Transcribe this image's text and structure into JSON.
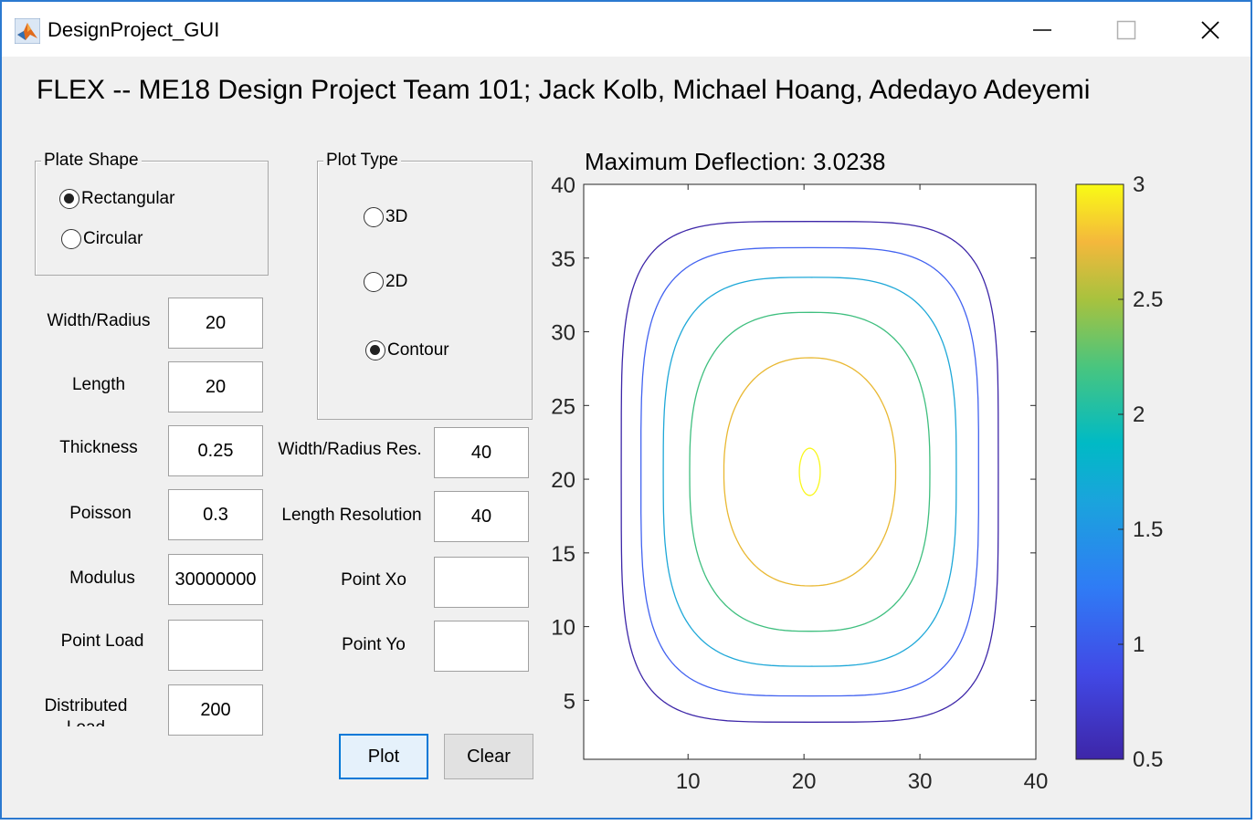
{
  "window": {
    "title": "DesignProject_GUI"
  },
  "heading": "FLEX -- ME18 Design Project Team 101; Jack Kolb, Michael Hoang, Adedayo Adeyemi",
  "plate_shape": {
    "title": "Plate Shape",
    "options": [
      {
        "label": "Rectangular",
        "selected": true
      },
      {
        "label": "Circular",
        "selected": false
      }
    ]
  },
  "plot_type": {
    "title": "Plot Type",
    "options": [
      {
        "label": "3D",
        "selected": false
      },
      {
        "label": "2D",
        "selected": false
      },
      {
        "label": "Contour",
        "selected": true
      }
    ]
  },
  "inputs": {
    "width_radius": {
      "label": "Width/Radius",
      "value": "20"
    },
    "length": {
      "label": "Length",
      "value": "20"
    },
    "thickness": {
      "label": "Thickness",
      "value": "0.25"
    },
    "poisson": {
      "label": "Poisson",
      "value": "0.3"
    },
    "modulus": {
      "label": "Modulus",
      "value": "30000000"
    },
    "point_load": {
      "label": "Point Load",
      "value": ""
    },
    "distributed_load": {
      "label": "Distributed Load",
      "value": "200"
    },
    "width_radius_res": {
      "label": "Width/Radius Res.",
      "value": "40"
    },
    "length_resolution": {
      "label": "Length Resolution",
      "value": "40"
    },
    "point_xo": {
      "label": "Point Xo",
      "value": ""
    },
    "point_yo": {
      "label": "Point Yo",
      "value": ""
    }
  },
  "buttons": {
    "plot": "Plot",
    "clear": "Clear"
  },
  "chart_data": {
    "type": "contour",
    "title": "Maximum Deflection: 3.0238",
    "xlim": [
      1,
      40
    ],
    "ylim": [
      1,
      40
    ],
    "x_ticks": [
      "10",
      "20",
      "30",
      "40"
    ],
    "y_ticks": [
      "5",
      "10",
      "15",
      "20",
      "25",
      "30",
      "35",
      "40"
    ],
    "contour_levels": [
      0.5,
      1,
      1.5,
      2,
      2.5,
      3
    ],
    "contour_colors": [
      "#3d26a8",
      "#4262f0",
      "#1fa8d8",
      "#3fbf7f",
      "#e9b832",
      "#f9f71d"
    ],
    "center": [
      20.5,
      20.5
    ],
    "colorbar": {
      "min": 0.5,
      "max": 3,
      "ticks": [
        "0.5",
        "1",
        "1.5",
        "2",
        "2.5",
        "3"
      ]
    }
  }
}
